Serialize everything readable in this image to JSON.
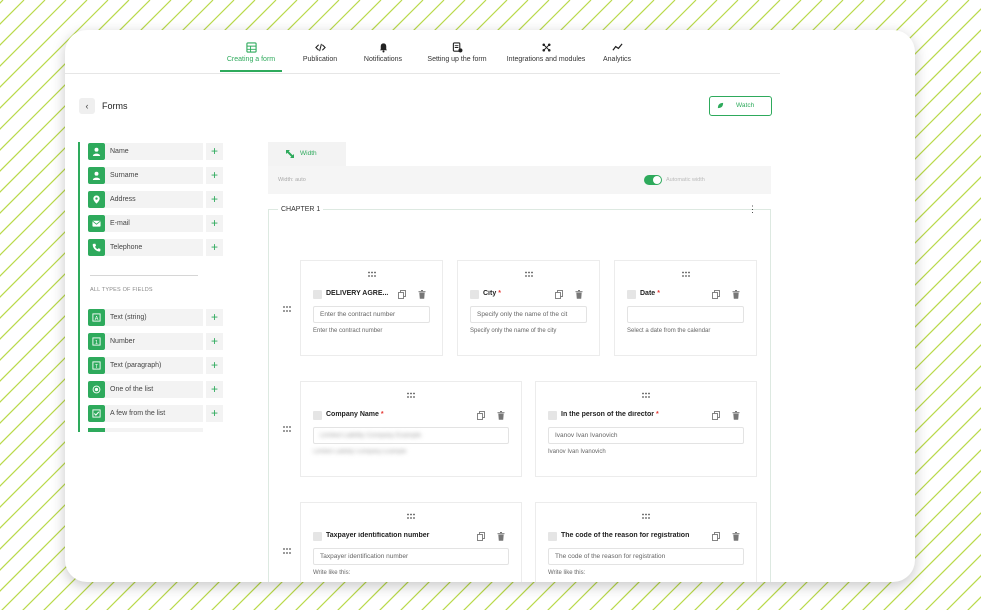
{
  "nav": {
    "tabs": [
      {
        "label": "Creating a form",
        "icon": "table-icon"
      },
      {
        "label": "Publication",
        "icon": "code-icon"
      },
      {
        "label": "Notifications",
        "icon": "bell-icon"
      },
      {
        "label": "Setting up the form",
        "icon": "form-settings-icon"
      },
      {
        "label": "Integrations and modules",
        "icon": "integrations-icon"
      },
      {
        "label": "Analytics",
        "icon": "analytics-icon"
      }
    ]
  },
  "header": {
    "title": "Forms",
    "watch_label": "Watch"
  },
  "sidebar": {
    "contact_fields": [
      {
        "label": "Name",
        "icon": "person-icon"
      },
      {
        "label": "Surname",
        "icon": "person-icon"
      },
      {
        "label": "Address",
        "icon": "location-pin-icon"
      },
      {
        "label": "E-mail",
        "icon": "envelope-icon"
      },
      {
        "label": "Telephone",
        "icon": "phone-icon"
      }
    ],
    "section_caption": "ALL TYPES OF FIELDS",
    "field_types": [
      {
        "label": "Text (string)",
        "icon": "text-string-icon"
      },
      {
        "label": "Number",
        "icon": "number-icon"
      },
      {
        "label": "Text (paragraph)",
        "icon": "text-paragraph-icon"
      },
      {
        "label": "One of the list",
        "icon": "radio-icon"
      },
      {
        "label": "A few from the list",
        "icon": "checkbox-icon"
      }
    ]
  },
  "width_panel": {
    "tab_label": "Width",
    "width_value": "Width: auto",
    "toggle_label": "Automatic width",
    "toggle_on": true
  },
  "chapter": {
    "title": "CHAPTER 1",
    "fields": [
      {
        "label": "DELIVERY AGRE...",
        "required": false,
        "placeholder": "Enter the contract number",
        "hint": "Enter the contract number"
      },
      {
        "label": "City",
        "required": true,
        "placeholder": "Specify only the name of the cit",
        "hint": "Specify only the name of the city"
      },
      {
        "label": "Date",
        "required": true,
        "placeholder": "",
        "hint": "Select a date from the calendar"
      },
      {
        "label": "Company Name",
        "required": true,
        "placeholder": "Limited Liability Company Example",
        "hint": "Limited Liability Company Example"
      },
      {
        "label": "In the person of the director",
        "required": true,
        "placeholder": "Ivanov Ivan Ivanovich",
        "hint": "Ivanov Ivan Ivanovich"
      },
      {
        "label": "Taxpayer identification number",
        "required": false,
        "placeholder": "Taxpayer identification number",
        "hint": "Write like this:"
      },
      {
        "label": "The code of the reason for registration",
        "required": false,
        "placeholder": "The code of the reason for registration",
        "hint": "Write like this:"
      }
    ]
  },
  "colors": {
    "accent": "#2eaa5c",
    "required": "#e53935",
    "stripe": "#b9d94a"
  }
}
